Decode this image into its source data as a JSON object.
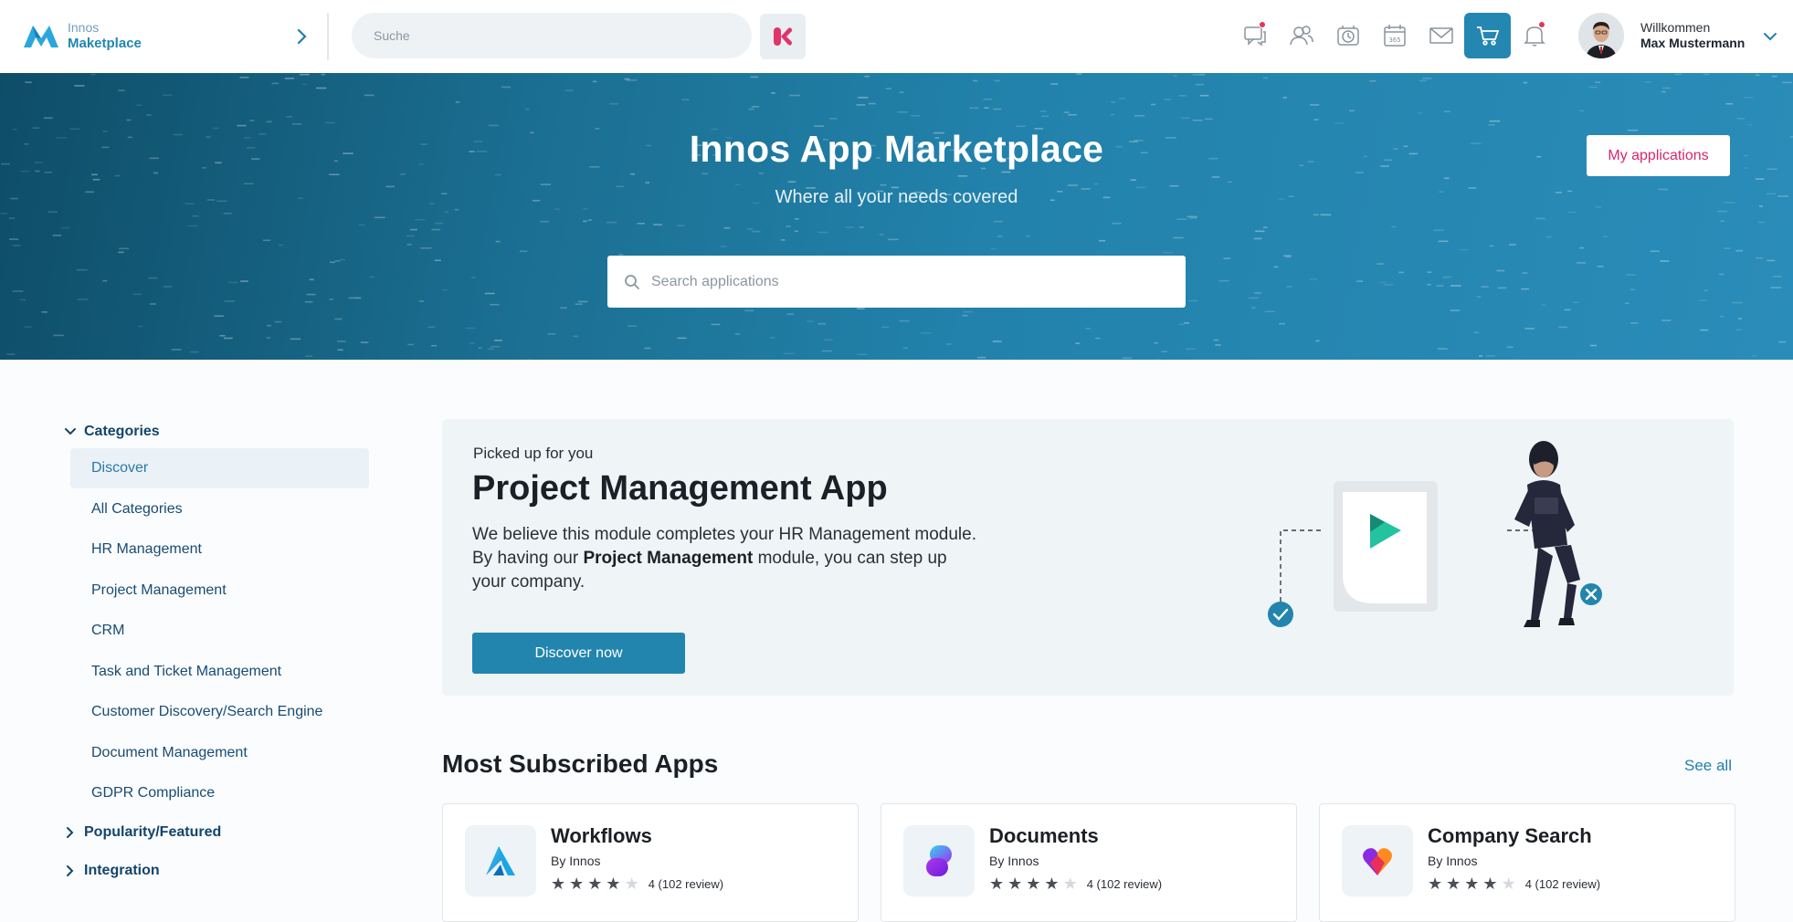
{
  "brand": {
    "line1": "Innos",
    "line2": "Maketplace"
  },
  "top_search": {
    "placeholder": "Suche"
  },
  "user": {
    "greeting": "Willkommen",
    "name": "Max Mustermann"
  },
  "top_icons": [
    {
      "name": "chat-icon",
      "badge": true
    },
    {
      "name": "people-icon",
      "badge": false
    },
    {
      "name": "clock-icon",
      "badge": false
    },
    {
      "name": "calendar-365-icon",
      "badge": false,
      "label": "365"
    },
    {
      "name": "mail-icon",
      "badge": false
    },
    {
      "name": "cart-icon",
      "badge": false,
      "active": true
    },
    {
      "name": "bell-icon",
      "badge": true
    }
  ],
  "hero": {
    "title": "Innos App Marketplace",
    "subtitle": "Where all your needs covered",
    "search_placeholder": "Search applications",
    "my_apps_label": "My applications"
  },
  "sidebar": {
    "categories_label": "Categories",
    "items": [
      {
        "label": "Discover",
        "active": true
      },
      {
        "label": "All Categories"
      },
      {
        "label": "HR Management"
      },
      {
        "label": "Project Management"
      },
      {
        "label": "CRM"
      },
      {
        "label": "Task and Ticket Management"
      },
      {
        "label": "Customer Discovery/Search Engine"
      },
      {
        "label": "Document Management"
      },
      {
        "label": "GDPR Compliance"
      }
    ],
    "groups": [
      {
        "label": "Popularity/Featured"
      },
      {
        "label": "Integration"
      }
    ]
  },
  "featured": {
    "kicker": "Picked up for you",
    "title": "Project Management App",
    "desc_part1": "We believe this module completes your HR Management module. By having our ",
    "desc_bold": "Project Management",
    "desc_part2": " module, you can step up your company.",
    "button_label": "Discover now"
  },
  "most_subscribed": {
    "title": "Most Subscribed Apps",
    "see_all": "See all",
    "apps": [
      {
        "name": "Workflows",
        "by": "By Innos",
        "rating": 4,
        "review": "4 (102 review)"
      },
      {
        "name": "Documents",
        "by": "By Innos",
        "rating": 4,
        "review": "4 (102 review)"
      },
      {
        "name": "Company Search",
        "by": "By Innos",
        "rating": 4,
        "review": "4 (102 review)"
      }
    ]
  },
  "colors": {
    "accent": "#2285ad",
    "pink": "#d4286f",
    "navy": "#13456b"
  }
}
